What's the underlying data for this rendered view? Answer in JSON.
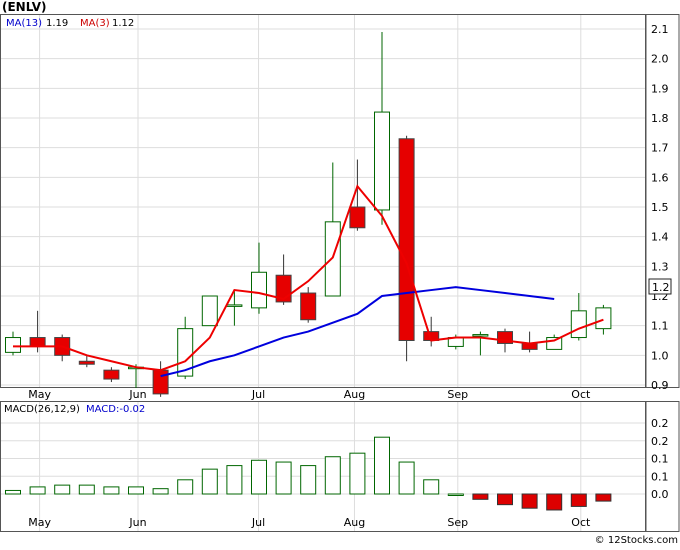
{
  "symbol_label": "(ENLV)",
  "price_legend": {
    "ma13_label": "MA(13)",
    "ma13_value": "1.19",
    "ma3_label": "MA(3)",
    "ma3_value": "1.12"
  },
  "macd_legend": {
    "label": "MACD(26,12,9)",
    "value_label": "MACD:-0.02"
  },
  "last_price_badge": "1.2",
  "watermark": "© 12Stocks.com",
  "colors": {
    "up_candle": "#006600",
    "down_candle": "#e60000",
    "ma13_line": "#0000dd",
    "ma3_line": "#ee0000",
    "grid": "#dddddd",
    "text": "#000000",
    "legend_value": "#0000cc",
    "histogram_positive": "#006600",
    "histogram_negative": "#dd0000"
  },
  "chart_data": [
    {
      "type": "candlestick",
      "panel": "price",
      "ylim": [
        0.87,
        2.14
      ],
      "y_ticks": [
        "0.9",
        "1.0",
        "1.1",
        "1.2",
        "1.3",
        "1.4",
        "1.5",
        "1.6",
        "1.7",
        "1.8",
        "1.9",
        "2.0",
        "2.1"
      ],
      "x_ticks": [
        "May",
        "Jun",
        "Jul",
        "Aug",
        "Sep",
        "Oct"
      ],
      "grid": true,
      "candles": [
        {
          "open": 1.01,
          "high": 1.08,
          "low": 1.0,
          "close": 1.06
        },
        {
          "open": 1.06,
          "high": 1.15,
          "low": 1.01,
          "close": 1.03
        },
        {
          "open": 1.06,
          "high": 1.07,
          "low": 0.98,
          "close": 1.0
        },
        {
          "open": 0.98,
          "high": 1.0,
          "low": 0.96,
          "close": 0.97
        },
        {
          "open": 0.95,
          "high": 0.96,
          "low": 0.91,
          "close": 0.92
        },
        {
          "open": 0.96,
          "high": 0.97,
          "low": 0.89,
          "close": 0.96
        },
        {
          "open": 0.95,
          "high": 0.98,
          "low": 0.86,
          "close": 0.87
        },
        {
          "open": 0.93,
          "high": 1.13,
          "low": 0.92,
          "close": 1.09
        },
        {
          "open": 1.1,
          "high": 1.19,
          "low": 1.1,
          "close": 1.2
        },
        {
          "open": 1.17,
          "high": 1.22,
          "low": 1.1,
          "close": 1.17
        },
        {
          "open": 1.16,
          "high": 1.38,
          "low": 1.14,
          "close": 1.28
        },
        {
          "open": 1.27,
          "high": 1.34,
          "low": 1.17,
          "close": 1.18
        },
        {
          "open": 1.21,
          "high": 1.23,
          "low": 1.11,
          "close": 1.12
        },
        {
          "open": 1.2,
          "high": 1.65,
          "low": 1.2,
          "close": 1.45
        },
        {
          "open": 1.5,
          "high": 1.66,
          "low": 1.42,
          "close": 1.43
        },
        {
          "open": 1.49,
          "high": 2.09,
          "low": 1.44,
          "close": 1.82
        },
        {
          "open": 1.73,
          "high": 1.74,
          "low": 0.98,
          "close": 1.05
        },
        {
          "open": 1.08,
          "high": 1.13,
          "low": 1.03,
          "close": 1.05
        },
        {
          "open": 1.03,
          "high": 1.07,
          "low": 1.02,
          "close": 1.06
        },
        {
          "open": 1.07,
          "high": 1.08,
          "low": 1.0,
          "close": 1.07
        },
        {
          "open": 1.08,
          "high": 1.09,
          "low": 1.01,
          "close": 1.04
        },
        {
          "open": 1.04,
          "high": 1.08,
          "low": 1.01,
          "close": 1.02
        },
        {
          "open": 1.02,
          "high": 1.07,
          "low": 1.02,
          "close": 1.06
        },
        {
          "open": 1.06,
          "high": 1.21,
          "low": 1.05,
          "close": 1.15
        },
        {
          "open": 1.09,
          "high": 1.17,
          "low": 1.07,
          "close": 1.16
        }
      ],
      "series": [
        {
          "name": "MA(13)",
          "start_index": 6,
          "values": [
            0.93,
            0.95,
            0.98,
            1.0,
            1.03,
            1.06,
            1.08,
            1.11,
            1.14,
            1.2,
            1.21,
            1.22,
            1.23,
            1.22,
            1.21,
            1.2,
            1.19
          ]
        },
        {
          "name": "MA(3)",
          "start_index": 0,
          "values": [
            1.03,
            1.03,
            1.03,
            1.0,
            0.98,
            0.96,
            0.95,
            0.98,
            1.06,
            1.22,
            1.21,
            1.19,
            1.25,
            1.33,
            1.57,
            1.47,
            1.31,
            1.05,
            1.06,
            1.06,
            1.05,
            1.04,
            1.05,
            1.09,
            1.12
          ]
        }
      ]
    },
    {
      "type": "bar",
      "panel": "macd",
      "ylim": [
        -0.04,
        0.26
      ],
      "y_ticks": [
        "0.0",
        "0.1",
        "0.1",
        "0.2"
      ],
      "y_tick_values": [
        0.0,
        0.05,
        0.1,
        0.15,
        0.2
      ],
      "y_tick_labels_shown": [
        "0.0",
        "0.1",
        "0.1",
        "0.2",
        "0.2"
      ],
      "x_ticks": [
        "May",
        "Jun",
        "Jul",
        "Aug",
        "Sep",
        "Oct"
      ],
      "grid": true,
      "values": [
        0.01,
        0.02,
        0.025,
        0.025,
        0.02,
        0.02,
        0.015,
        0.04,
        0.07,
        0.08,
        0.095,
        0.09,
        0.08,
        0.105,
        0.115,
        0.16,
        0.09,
        0.04,
        0.0,
        -0.015,
        -0.03,
        -0.04,
        -0.045,
        -0.035,
        -0.02
      ]
    }
  ]
}
